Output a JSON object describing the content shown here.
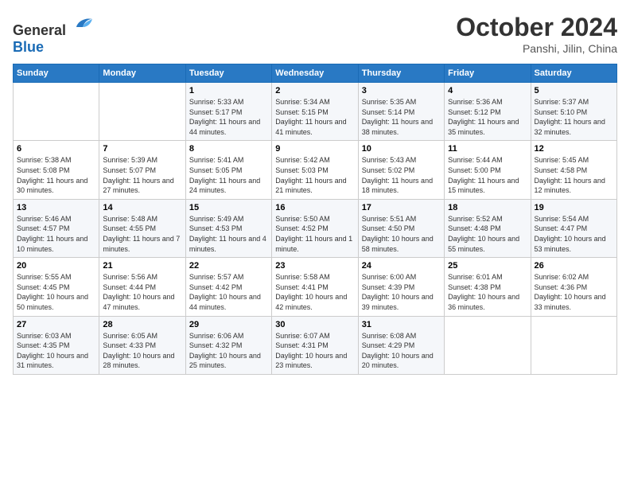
{
  "header": {
    "logo_general": "General",
    "logo_blue": "Blue",
    "month": "October 2024",
    "location": "Panshi, Jilin, China"
  },
  "days_of_week": [
    "Sunday",
    "Monday",
    "Tuesday",
    "Wednesday",
    "Thursday",
    "Friday",
    "Saturday"
  ],
  "weeks": [
    [
      {
        "day": "",
        "info": ""
      },
      {
        "day": "",
        "info": ""
      },
      {
        "day": "1",
        "info": "Sunrise: 5:33 AM\nSunset: 5:17 PM\nDaylight: 11 hours and 44 minutes."
      },
      {
        "day": "2",
        "info": "Sunrise: 5:34 AM\nSunset: 5:15 PM\nDaylight: 11 hours and 41 minutes."
      },
      {
        "day": "3",
        "info": "Sunrise: 5:35 AM\nSunset: 5:14 PM\nDaylight: 11 hours and 38 minutes."
      },
      {
        "day": "4",
        "info": "Sunrise: 5:36 AM\nSunset: 5:12 PM\nDaylight: 11 hours and 35 minutes."
      },
      {
        "day": "5",
        "info": "Sunrise: 5:37 AM\nSunset: 5:10 PM\nDaylight: 11 hours and 32 minutes."
      }
    ],
    [
      {
        "day": "6",
        "info": "Sunrise: 5:38 AM\nSunset: 5:08 PM\nDaylight: 11 hours and 30 minutes."
      },
      {
        "day": "7",
        "info": "Sunrise: 5:39 AM\nSunset: 5:07 PM\nDaylight: 11 hours and 27 minutes."
      },
      {
        "day": "8",
        "info": "Sunrise: 5:41 AM\nSunset: 5:05 PM\nDaylight: 11 hours and 24 minutes."
      },
      {
        "day": "9",
        "info": "Sunrise: 5:42 AM\nSunset: 5:03 PM\nDaylight: 11 hours and 21 minutes."
      },
      {
        "day": "10",
        "info": "Sunrise: 5:43 AM\nSunset: 5:02 PM\nDaylight: 11 hours and 18 minutes."
      },
      {
        "day": "11",
        "info": "Sunrise: 5:44 AM\nSunset: 5:00 PM\nDaylight: 11 hours and 15 minutes."
      },
      {
        "day": "12",
        "info": "Sunrise: 5:45 AM\nSunset: 4:58 PM\nDaylight: 11 hours and 12 minutes."
      }
    ],
    [
      {
        "day": "13",
        "info": "Sunrise: 5:46 AM\nSunset: 4:57 PM\nDaylight: 11 hours and 10 minutes."
      },
      {
        "day": "14",
        "info": "Sunrise: 5:48 AM\nSunset: 4:55 PM\nDaylight: 11 hours and 7 minutes."
      },
      {
        "day": "15",
        "info": "Sunrise: 5:49 AM\nSunset: 4:53 PM\nDaylight: 11 hours and 4 minutes."
      },
      {
        "day": "16",
        "info": "Sunrise: 5:50 AM\nSunset: 4:52 PM\nDaylight: 11 hours and 1 minute."
      },
      {
        "day": "17",
        "info": "Sunrise: 5:51 AM\nSunset: 4:50 PM\nDaylight: 10 hours and 58 minutes."
      },
      {
        "day": "18",
        "info": "Sunrise: 5:52 AM\nSunset: 4:48 PM\nDaylight: 10 hours and 55 minutes."
      },
      {
        "day": "19",
        "info": "Sunrise: 5:54 AM\nSunset: 4:47 PM\nDaylight: 10 hours and 53 minutes."
      }
    ],
    [
      {
        "day": "20",
        "info": "Sunrise: 5:55 AM\nSunset: 4:45 PM\nDaylight: 10 hours and 50 minutes."
      },
      {
        "day": "21",
        "info": "Sunrise: 5:56 AM\nSunset: 4:44 PM\nDaylight: 10 hours and 47 minutes."
      },
      {
        "day": "22",
        "info": "Sunrise: 5:57 AM\nSunset: 4:42 PM\nDaylight: 10 hours and 44 minutes."
      },
      {
        "day": "23",
        "info": "Sunrise: 5:58 AM\nSunset: 4:41 PM\nDaylight: 10 hours and 42 minutes."
      },
      {
        "day": "24",
        "info": "Sunrise: 6:00 AM\nSunset: 4:39 PM\nDaylight: 10 hours and 39 minutes."
      },
      {
        "day": "25",
        "info": "Sunrise: 6:01 AM\nSunset: 4:38 PM\nDaylight: 10 hours and 36 minutes."
      },
      {
        "day": "26",
        "info": "Sunrise: 6:02 AM\nSunset: 4:36 PM\nDaylight: 10 hours and 33 minutes."
      }
    ],
    [
      {
        "day": "27",
        "info": "Sunrise: 6:03 AM\nSunset: 4:35 PM\nDaylight: 10 hours and 31 minutes."
      },
      {
        "day": "28",
        "info": "Sunrise: 6:05 AM\nSunset: 4:33 PM\nDaylight: 10 hours and 28 minutes."
      },
      {
        "day": "29",
        "info": "Sunrise: 6:06 AM\nSunset: 4:32 PM\nDaylight: 10 hours and 25 minutes."
      },
      {
        "day": "30",
        "info": "Sunrise: 6:07 AM\nSunset: 4:31 PM\nDaylight: 10 hours and 23 minutes."
      },
      {
        "day": "31",
        "info": "Sunrise: 6:08 AM\nSunset: 4:29 PM\nDaylight: 10 hours and 20 minutes."
      },
      {
        "day": "",
        "info": ""
      },
      {
        "day": "",
        "info": ""
      }
    ]
  ]
}
